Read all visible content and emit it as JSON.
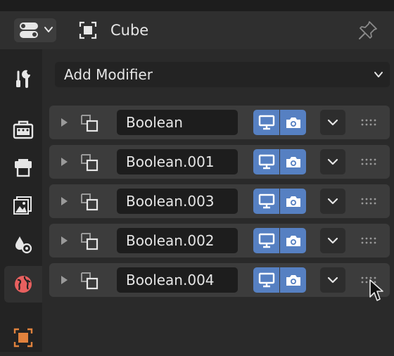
{
  "header": {
    "object_name": "Cube",
    "editor_icon": "properties-editor-type-icon",
    "object_icon": "object-data-icon",
    "pin_icon": "pin-icon"
  },
  "tabs": [
    {
      "icon": "tool-icon"
    },
    {
      "icon": "render-icon"
    },
    {
      "icon": "output-icon"
    },
    {
      "icon": "view-layer-icon"
    },
    {
      "icon": "scene-icon"
    },
    {
      "icon": "world-icon"
    },
    {
      "icon": "object-icon"
    }
  ],
  "add_modifier": {
    "label": "Add Modifier"
  },
  "modifiers": [
    {
      "name": "Boolean"
    },
    {
      "name": "Boolean.001"
    },
    {
      "name": "Boolean.003"
    },
    {
      "name": "Boolean.002"
    },
    {
      "name": "Boolean.004"
    }
  ],
  "colors": {
    "accent": "#5680c2",
    "panel": "#3c3c3c",
    "field": "#1d1d1d",
    "object_tab": "#e0823d"
  }
}
